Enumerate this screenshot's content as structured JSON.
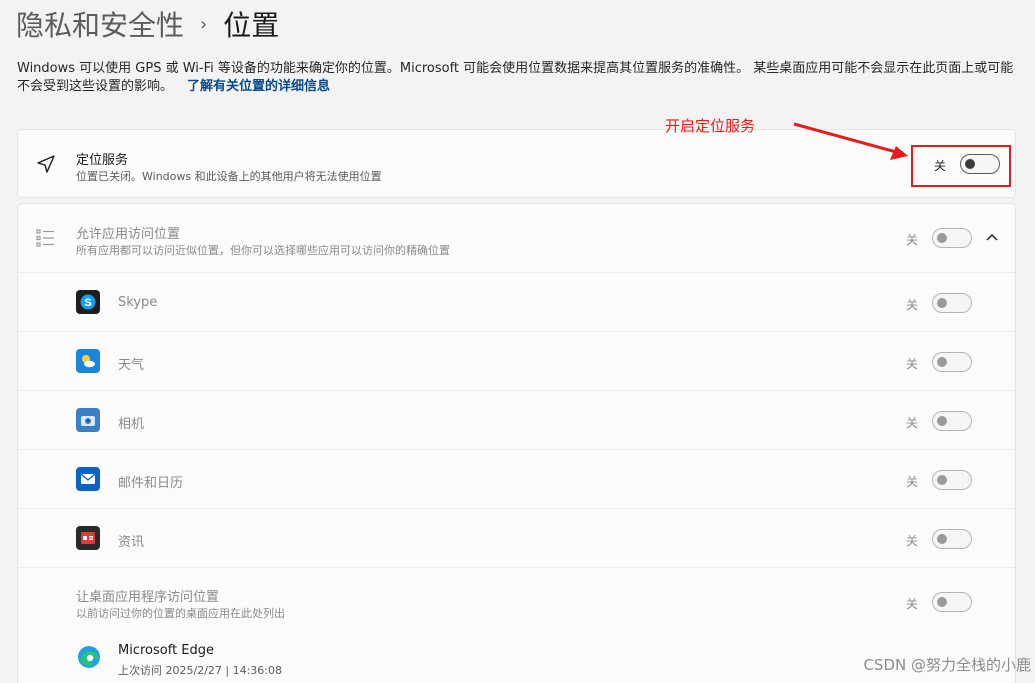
{
  "breadcrumb": {
    "parent": "隐私和安全性",
    "separator": "›",
    "current": "位置"
  },
  "description": {
    "text": "Windows 可以使用 GPS 或 Wi-Fi 等设备的功能来确定你的位置。Microsoft 可能会使用位置数据来提高其位置服务的准确性。 某些桌面应用可能不会显示在此页面上或可能不会受到这些设置的影响。",
    "link": "了解有关位置的详细信息"
  },
  "location_service": {
    "icon": "location-arrow-icon",
    "title": "定位服务",
    "subtitle": "位置已关闭。Windows 和此设备上的其他用户将无法使用位置",
    "state": "关",
    "on": false
  },
  "app_access": {
    "icon": "list-icon",
    "title": "允许应用访问位置",
    "subtitle": "所有应用都可以访问近似位置，但你可以选择哪些应用可以访问你的精确位置",
    "state": "关",
    "expanded": true
  },
  "apps": [
    {
      "name": "Skype",
      "state": "关",
      "icon": "skype-icon",
      "color": "#0078d4"
    },
    {
      "name": "天气",
      "state": "关",
      "icon": "weather-icon",
      "color": "#1a86d9"
    },
    {
      "name": "相机",
      "state": "关",
      "icon": "camera-icon",
      "color": "#3b7fc4"
    },
    {
      "name": "邮件和日历",
      "state": "关",
      "icon": "mail-icon",
      "color": "#0a64c8"
    },
    {
      "name": "资讯",
      "state": "关",
      "icon": "news-icon",
      "color": "#c4262e"
    }
  ],
  "desktop_apps": {
    "title": "让桌面应用程序访问位置",
    "subtitle": "以前访问过你的位置的桌面应用在此处列出",
    "state": "关"
  },
  "edge": {
    "name": "Microsoft Edge",
    "last_access": "上次访问 2025/2/27 | 14:36:08",
    "icon": "edge-icon"
  },
  "annotation": {
    "text": "开启定位服务",
    "color": "#e41c1c"
  },
  "watermark": "CSDN @努力全栈的小鹿"
}
